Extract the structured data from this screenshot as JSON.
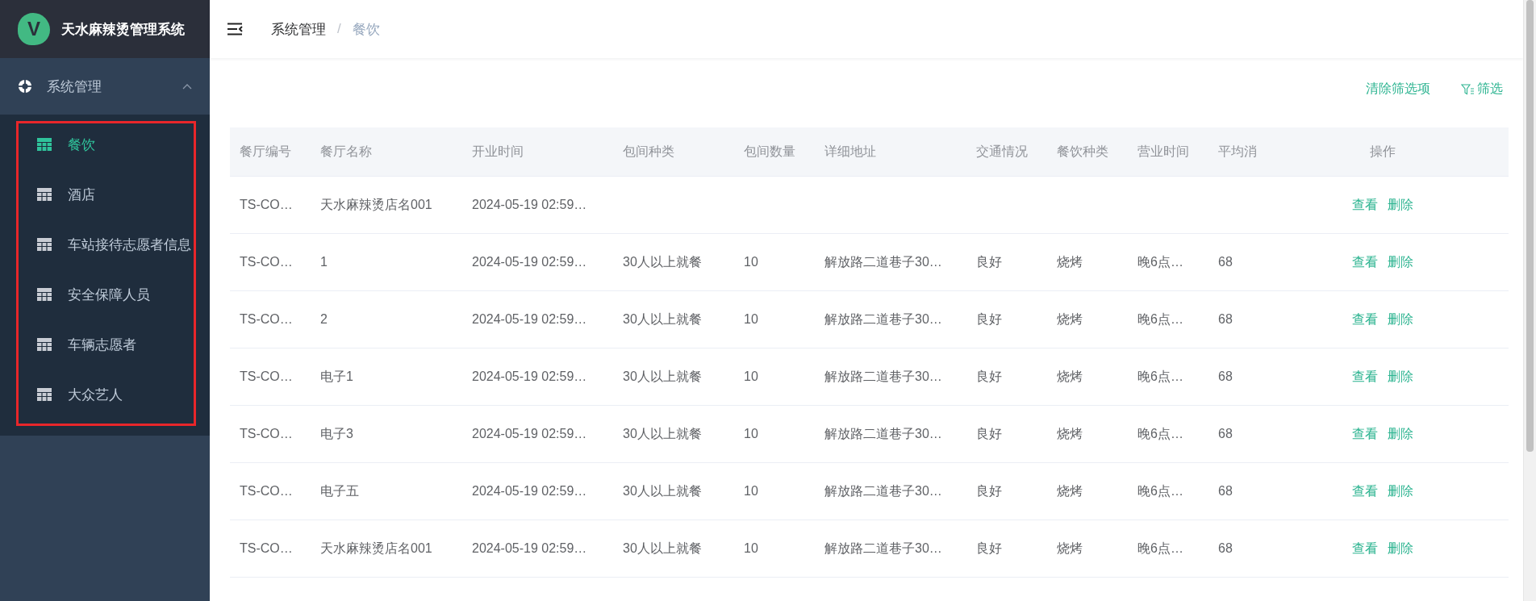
{
  "sidebar": {
    "logo_letter": "V",
    "title": "天水麻辣烫管理系统",
    "menu": [
      {
        "label": "系统管理",
        "expanded": true,
        "items": [
          {
            "label": "餐饮",
            "selected": true
          },
          {
            "label": "酒店",
            "selected": false
          },
          {
            "label": "车站接待志愿者信息",
            "selected": false
          },
          {
            "label": "安全保障人员",
            "selected": false
          },
          {
            "label": "车辆志愿者",
            "selected": false
          },
          {
            "label": "大众艺人",
            "selected": false
          }
        ]
      }
    ]
  },
  "breadcrumb": [
    "系统管理",
    "餐饮"
  ],
  "breadcrumb_separator": "/",
  "toolbar": {
    "clear_link": "清除筛选项",
    "filter_link": "筛选"
  },
  "table": {
    "columns": [
      "餐厅编号",
      "餐厅名称",
      "开业时间",
      "包间种类",
      "包间数量",
      "详细地址",
      "交通情况",
      "餐饮种类",
      "营业时间",
      "平均消"
    ],
    "action_column": "操作",
    "rows": [
      {
        "cells": [
          "TS-CO…",
          "天水麻辣烫店名001",
          "2024-05-19 02:59…"
        ],
        "actions": [
          "查看",
          "删除"
        ]
      },
      {
        "cells": [
          "TS-CO…",
          "1",
          "2024-05-19 02:59…",
          "30人以上就餐",
          "10",
          "解放路二道巷子30…",
          "良好",
          "烧烤",
          "晚6点…",
          "68"
        ],
        "actions": [
          "查看",
          "删除"
        ]
      },
      {
        "cells": [
          "TS-CO…",
          "2",
          "2024-05-19 02:59…",
          "30人以上就餐",
          "10",
          "解放路二道巷子30…",
          "良好",
          "烧烤",
          "晚6点…",
          "68"
        ],
        "actions": [
          "查看",
          "删除"
        ]
      },
      {
        "cells": [
          "TS-CO…",
          "电子1",
          "2024-05-19 02:59…",
          "30人以上就餐",
          "10",
          "解放路二道巷子30…",
          "良好",
          "烧烤",
          "晚6点…",
          "68"
        ],
        "actions": [
          "查看",
          "删除"
        ]
      },
      {
        "cells": [
          "TS-CO…",
          "电子3",
          "2024-05-19 02:59…",
          "30人以上就餐",
          "10",
          "解放路二道巷子30…",
          "良好",
          "烧烤",
          "晚6点…",
          "68"
        ],
        "actions": [
          "查看",
          "删除"
        ]
      },
      {
        "cells": [
          "TS-CO…",
          "电子五",
          "2024-05-19 02:59…",
          "30人以上就餐",
          "10",
          "解放路二道巷子30…",
          "良好",
          "烧烤",
          "晚6点…",
          "68"
        ],
        "actions": [
          "查看",
          "删除"
        ]
      },
      {
        "cells": [
          "TS-CO…",
          "天水麻辣烫店名001",
          "2024-05-19 02:59…",
          "30人以上就餐",
          "10",
          "解放路二道巷子30…",
          "良好",
          "烧烤",
          "晚6点…",
          "68"
        ],
        "actions": [
          "查看",
          "删除"
        ]
      }
    ]
  }
}
